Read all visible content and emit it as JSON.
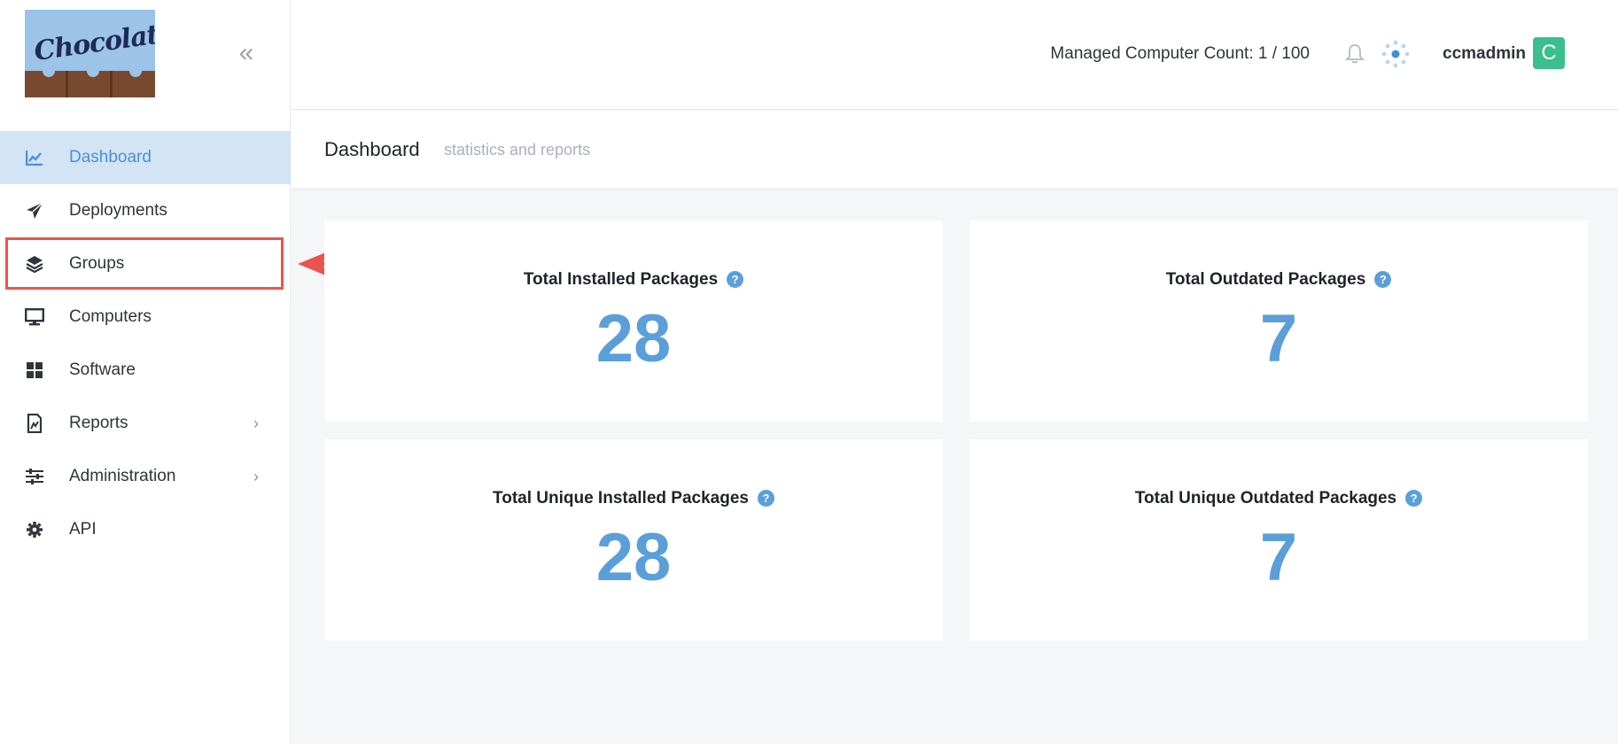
{
  "brand": {
    "logo_text": "Chocolatey"
  },
  "sidebar": {
    "collapse_icon": "double-chevron-left-icon",
    "items": [
      {
        "label": "Dashboard",
        "icon": "chart-line-icon",
        "active": true
      },
      {
        "label": "Deployments",
        "icon": "paper-plane-icon"
      },
      {
        "label": "Groups",
        "icon": "layers-icon",
        "highlighted": true
      },
      {
        "label": "Computers",
        "icon": "monitor-icon"
      },
      {
        "label": "Software",
        "icon": "grid-icon"
      },
      {
        "label": "Reports",
        "icon": "report-icon",
        "has_submenu": true
      },
      {
        "label": "Administration",
        "icon": "sliders-icon",
        "has_submenu": true
      },
      {
        "label": "API",
        "icon": "gear-icon"
      }
    ]
  },
  "topbar": {
    "managed_count_label": "Managed Computer Count: 1 / 100",
    "username": "ccmadmin",
    "avatar_letter": "C"
  },
  "page": {
    "title": "Dashboard",
    "subtitle": "statistics and reports"
  },
  "cards": [
    {
      "title": "Total Installed Packages",
      "value": "28"
    },
    {
      "title": "Total Outdated Packages",
      "value": "7"
    },
    {
      "title": "Total Unique Installed Packages",
      "value": "28"
    },
    {
      "title": "Total Unique Outdated Packages",
      "value": "7"
    }
  ],
  "colors": {
    "accent": "#5b9fd9",
    "active_bg": "#d3e4f5",
    "avatar_bg": "#3bbf8f",
    "highlight": "#e8554e"
  }
}
